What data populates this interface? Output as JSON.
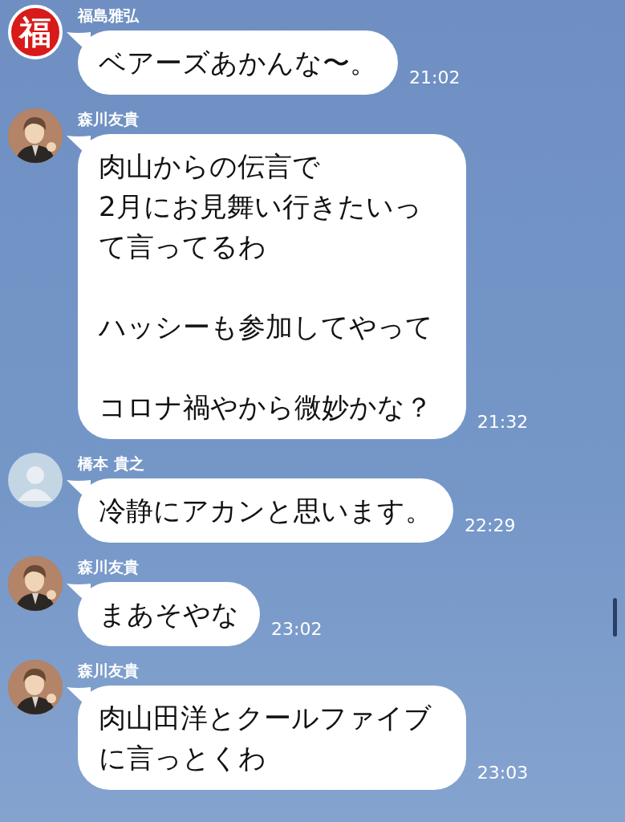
{
  "messages": [
    {
      "sender": "福島雅弘",
      "avatar": {
        "kind": "glyph",
        "glyph": "福"
      },
      "paragraphs": [
        "ベアーズあかんな〜。"
      ],
      "time": "21:02"
    },
    {
      "sender": "森川友貴",
      "avatar": {
        "kind": "illustration"
      },
      "paragraphs": [
        "肉山からの伝言で\n2月にお見舞い行きたいって言ってるわ",
        "ハッシーも参加してやって",
        "コロナ禍やから微妙かな？"
      ],
      "time": "21:32"
    },
    {
      "sender": "橋本 貴之",
      "avatar": {
        "kind": "default"
      },
      "paragraphs": [
        "冷静にアカンと思います。"
      ],
      "time": "22:29"
    },
    {
      "sender": "森川友貴",
      "avatar": {
        "kind": "illustration"
      },
      "paragraphs": [
        "まあそやな"
      ],
      "time": "23:02"
    },
    {
      "sender": "森川友貴",
      "avatar": {
        "kind": "illustration"
      },
      "paragraphs": [
        "肉山田洋とクールファイブに言っとくわ"
      ],
      "time": "23:03"
    }
  ]
}
